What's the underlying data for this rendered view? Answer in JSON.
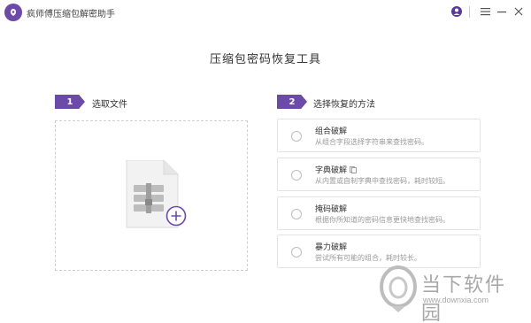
{
  "window": {
    "title": "疯师傅压缩包解密助手"
  },
  "page": {
    "title": "压缩包密码恢复工具"
  },
  "step1": {
    "number": "1",
    "label": "选取文件"
  },
  "step2": {
    "number": "2",
    "label": "选择恢复的方法"
  },
  "methods": [
    {
      "title": "组合破解",
      "desc": "从组合字段选择字符串来查找密码。"
    },
    {
      "title": "字典破解",
      "desc": "从内置或自制字典中查找密码，耗时较短。"
    },
    {
      "title": "掩码破解",
      "desc": "根据你所知道的密码信息更快地查找密码。"
    },
    {
      "title": "暴力破解",
      "desc": "尝试所有可能的组合，耗时较长。"
    }
  ],
  "watermark": {
    "text": "当下软件园",
    "url": "www.downxia.com"
  },
  "colors": {
    "accent": "#6c4aa8",
    "border": "#e3e3e3"
  }
}
